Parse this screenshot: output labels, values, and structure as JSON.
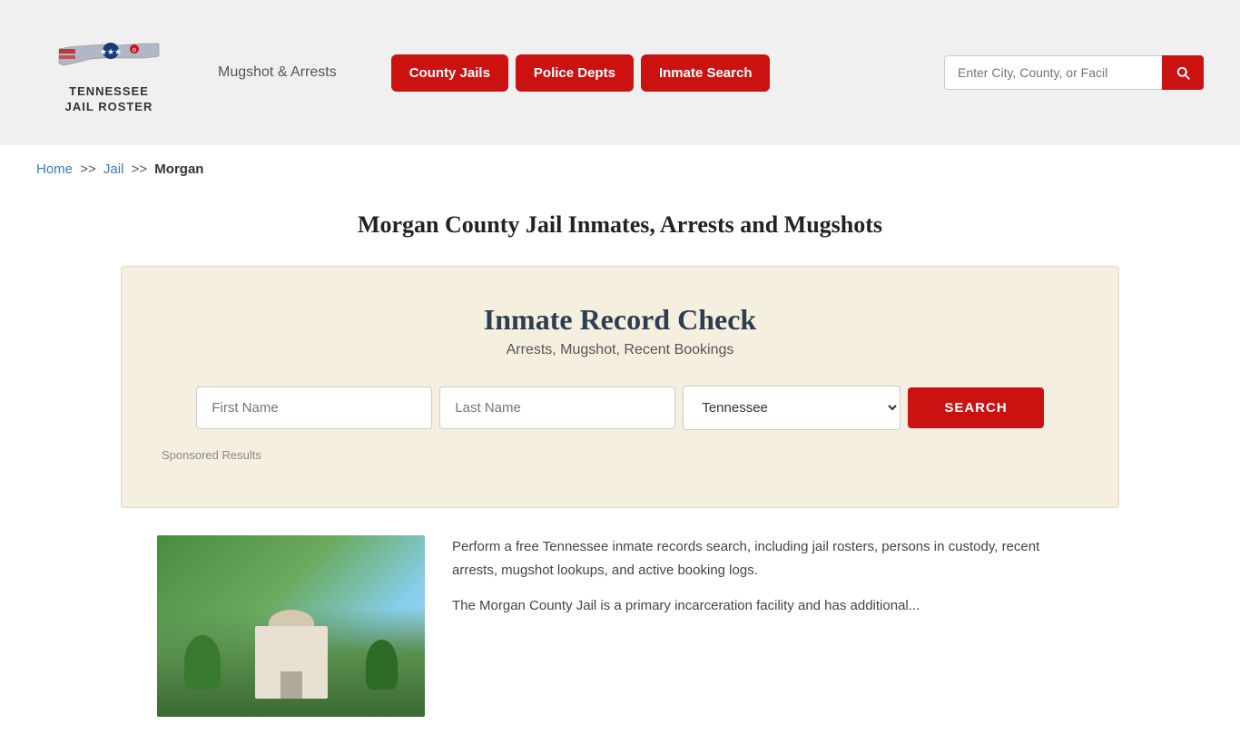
{
  "header": {
    "logo_text_line1": "TENNESSEE",
    "logo_text_line2": "JAIL ROSTER",
    "mugshot_link": "Mugshot & Arrests",
    "nav_buttons": [
      {
        "id": "county-jails",
        "label": "County Jails"
      },
      {
        "id": "police-depts",
        "label": "Police Depts"
      },
      {
        "id": "inmate-search",
        "label": "Inmate Search"
      }
    ],
    "search_placeholder": "Enter City, County, or Facil"
  },
  "breadcrumb": {
    "home_label": "Home",
    "sep1": ">>",
    "jail_label": "Jail",
    "sep2": ">>",
    "current": "Morgan"
  },
  "page_title": "Morgan County Jail Inmates, Arrests and Mugshots",
  "record_check": {
    "title": "Inmate Record Check",
    "subtitle": "Arrests, Mugshot, Recent Bookings",
    "first_name_placeholder": "First Name",
    "last_name_placeholder": "Last Name",
    "state_default": "Tennessee",
    "search_button": "SEARCH",
    "sponsored_label": "Sponsored Results"
  },
  "content": {
    "para1": "Perform a free Tennessee inmate records search, including jail rosters, persons in custody, recent arrests, mugshot lookups, and active booking logs.",
    "para2": "The Morgan County Jail is a primary incarceration facility and has additional..."
  }
}
